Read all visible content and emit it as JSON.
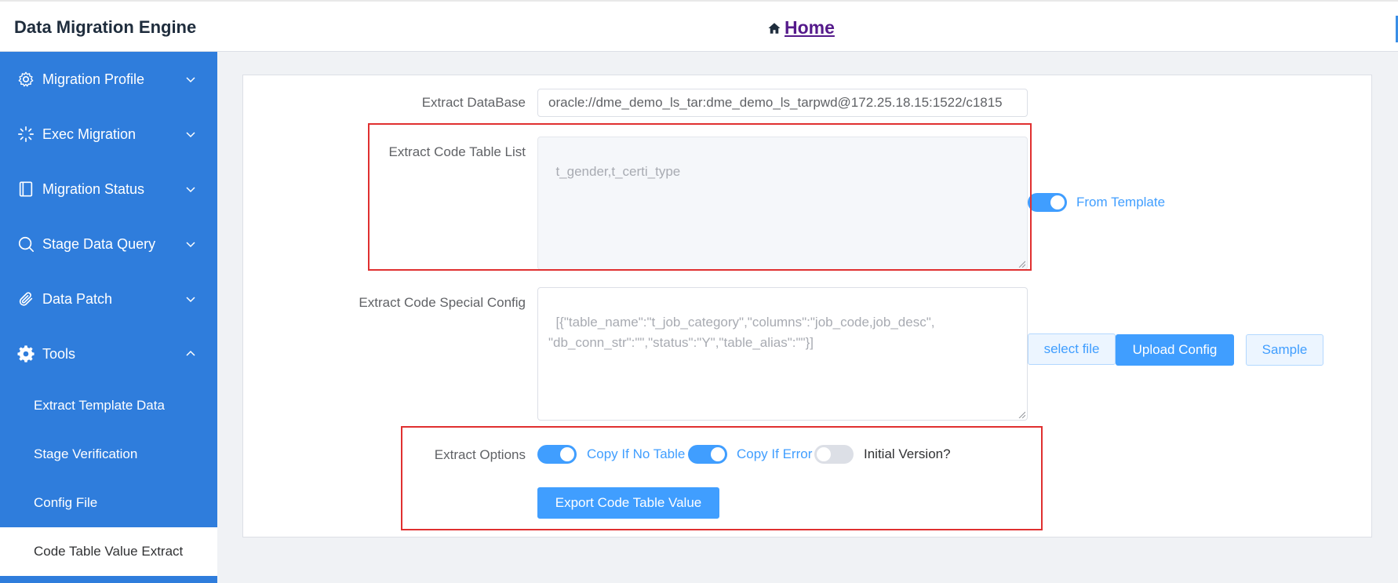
{
  "app": {
    "title": "Data Migration Engine"
  },
  "header": {
    "home_label": "Home"
  },
  "sidebar": {
    "menus": [
      {
        "label": "Migration Profile",
        "icon": "gear-outline-icon"
      },
      {
        "label": "Exec Migration",
        "icon": "loading-icon"
      },
      {
        "label": "Migration Status",
        "icon": "notebook-icon"
      },
      {
        "label": "Stage Data Query",
        "icon": "search-icon"
      },
      {
        "label": "Data Patch",
        "icon": "paperclip-icon"
      },
      {
        "label": "Tools",
        "icon": "gear-filled-icon",
        "expanded": true
      }
    ],
    "tools_items": [
      {
        "label": "Extract Template Data"
      },
      {
        "label": "Stage Verification"
      },
      {
        "label": "Config File"
      },
      {
        "label": "Code Table Value Extract",
        "active": true
      }
    ]
  },
  "form": {
    "extract_database": {
      "label": "Extract DataBase",
      "value": "oracle://dme_demo_ls_tar:dme_demo_ls_tarpwd@172.25.18.15:1522/c1815"
    },
    "code_table_list": {
      "label": "Extract Code Table List",
      "placeholder": "t_gender,t_certi_type",
      "disabled": true,
      "from_template": {
        "label": "From Template",
        "on": true
      }
    },
    "special_config": {
      "label": "Extract Code Special Config",
      "placeholder": "[{\"table_name\":\"t_job_category\",\"columns\":\"job_code,job_desc\",\n\"db_conn_str\":\"\",\"status\":\"Y\",\"table_alias\":\"\"}]",
      "select_file_label": "select file",
      "upload_label": "Upload Config",
      "sample_label": "Sample"
    },
    "extract_options": {
      "label": "Extract Options",
      "switches": [
        {
          "label": "Copy If No Table",
          "on": true
        },
        {
          "label": "Copy If Error",
          "on": true
        },
        {
          "label": "Initial Version?",
          "on": false
        }
      ],
      "export_label": "Export Code Table Value"
    }
  },
  "colors": {
    "sidebar": "#2f7ddc",
    "primary": "#409eff",
    "highlight_box": "#e03030"
  }
}
